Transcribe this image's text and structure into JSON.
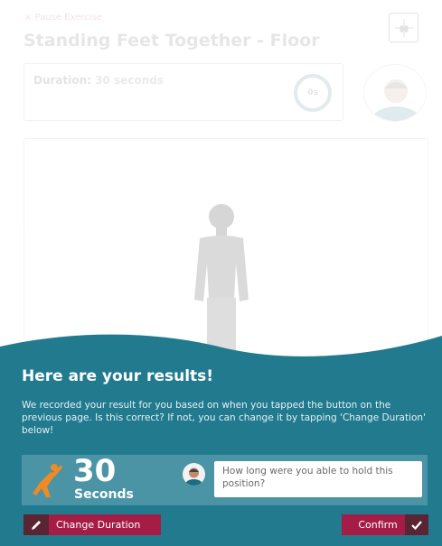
{
  "exercise": {
    "pause_label": "× Pause Exercise",
    "title": "Standing Feet Together - Floor",
    "duration_label": "Duration:",
    "duration_value": "30 seconds",
    "timer_text": "0s"
  },
  "results": {
    "title": "Here are your results!",
    "description": "We recorded your result for you based on when you tapped the button on the previous page. Is this correct? If not, you can change it by tapping 'Change Duration' below!",
    "value": "30",
    "unit": "Seconds",
    "question": "How long were you able to hold this position?",
    "change_button": "Change Duration",
    "confirm_button": "Confirm"
  },
  "colors": {
    "panel": "#227a8f",
    "card": "#4a94a6",
    "button": "#a51c45",
    "accent_orange": "#f08a24"
  },
  "icons": {
    "runner": "stretch-person-icon",
    "pencil": "pencil-icon",
    "check": "checkmark-icon",
    "foot": "feet-position-icon"
  }
}
